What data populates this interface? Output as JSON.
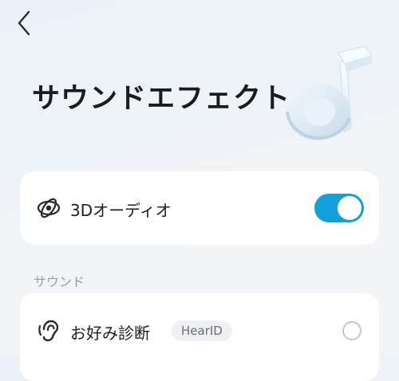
{
  "header": {
    "back_icon": "chevron-left-icon",
    "title": "サウンドエフェクト",
    "logo_icon": "music-note-3d-logo"
  },
  "audio3d": {
    "icon": "3d-orbit-icon",
    "label": "3Dオーディオ",
    "enabled": true,
    "accent": "#13a0d8"
  },
  "sound_section": {
    "label": "サウンド",
    "items": [
      {
        "icon": "ear-icon",
        "label": "お好み診断",
        "badge": "HearID",
        "selected": false
      }
    ]
  }
}
